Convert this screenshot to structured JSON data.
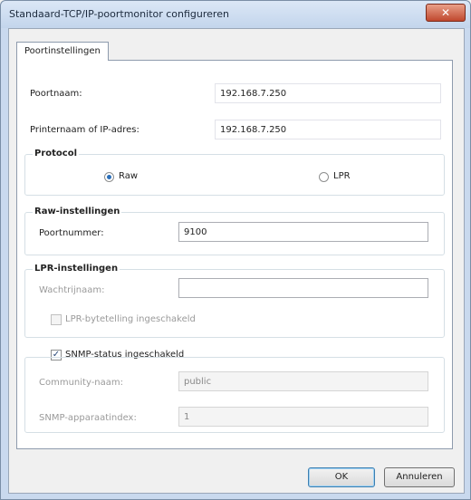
{
  "window": {
    "title": "Standaard-TCP/IP-poortmonitor configureren",
    "close_glyph": "✕"
  },
  "tab": {
    "label": "Poortinstellingen"
  },
  "form": {
    "port_name": {
      "label": "Poortnaam:",
      "value": "192.168.7.250"
    },
    "printer_name_or_ip": {
      "label": "Printernaam of IP-adres:",
      "value": "192.168.7.250"
    }
  },
  "protocol": {
    "title": "Protocol",
    "options": [
      {
        "label": "Raw",
        "selected": true
      },
      {
        "label": "LPR",
        "selected": false
      }
    ]
  },
  "raw_settings": {
    "title": "Raw-instellingen",
    "port_number": {
      "label": "Poortnummer:",
      "value": "9100"
    }
  },
  "lpr_settings": {
    "title": "LPR-instellingen",
    "queue_name": {
      "label": "Wachtrijnaam:",
      "value": ""
    },
    "byte_counting": {
      "label": "LPR-bytetelling ingeschakeld",
      "checked": false
    }
  },
  "snmp": {
    "enabled": {
      "label": "SNMP-status ingeschakeld",
      "checked": true,
      "glyph": "✓"
    },
    "community_name": {
      "label": "Community-naam:",
      "value": "public"
    },
    "device_index": {
      "label": "SNMP-apparaatindex:",
      "value": "1"
    }
  },
  "buttons": {
    "ok": "OK",
    "cancel": "Annuleren"
  },
  "colors": {
    "accent": "#2b6fb9",
    "close_button": "#c0482e"
  }
}
